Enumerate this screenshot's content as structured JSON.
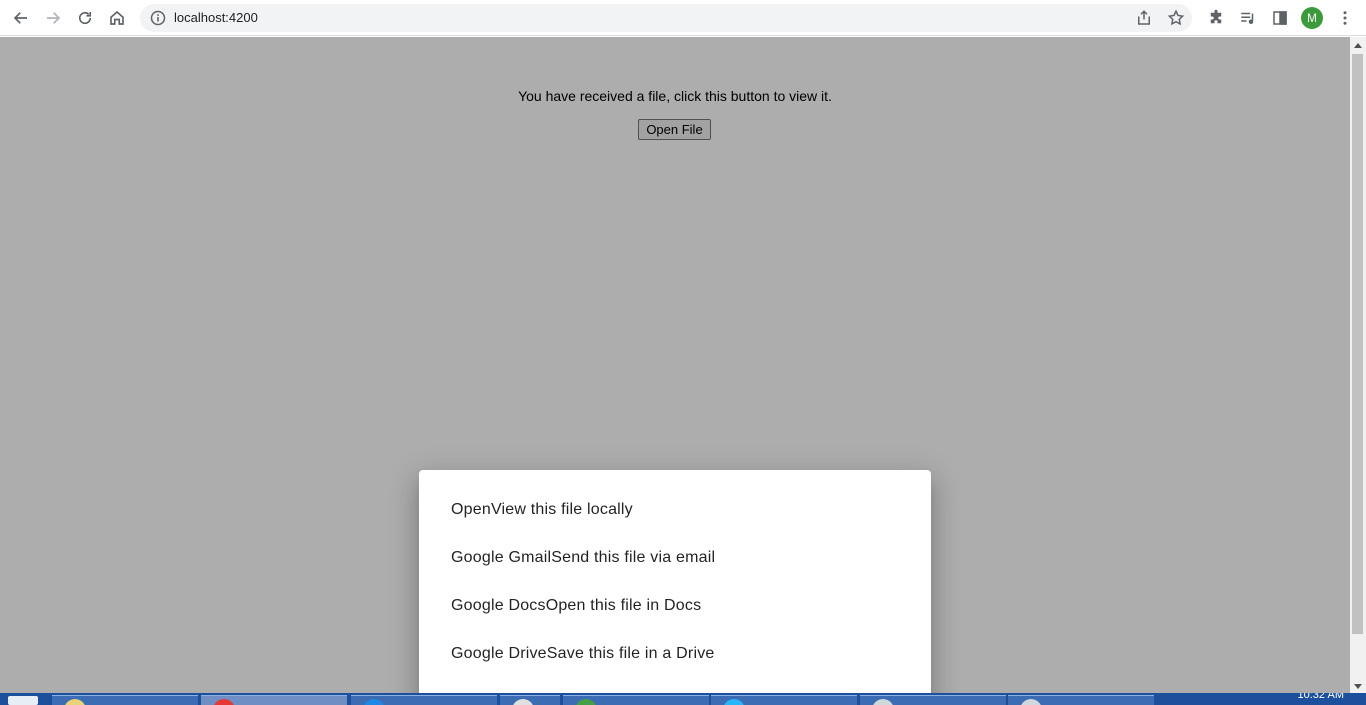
{
  "browser": {
    "url": "localhost:4200",
    "avatar_letter": "M",
    "icons": {
      "back": "back-arrow-icon",
      "forward": "forward-arrow-icon",
      "reload": "reload-icon",
      "home": "home-icon",
      "site_info": "info-icon",
      "share": "share-icon",
      "bookmark": "star-icon",
      "extensions": "puzzle-icon",
      "media": "media-queue-icon",
      "side_panel": "side-panel-icon",
      "menu": "kebab-menu-icon"
    }
  },
  "page": {
    "message": "You have received a file, click this button to view it.",
    "open_button_label": "Open File"
  },
  "bottom_sheet": {
    "items": [
      {
        "label": "OpenView this file locally"
      },
      {
        "label": "Google GmailSend this file via email"
      },
      {
        "label": "Google DocsOpen this file in Docs"
      },
      {
        "label": "Google DriveSave this file in a Drive"
      }
    ]
  },
  "taskbar": {
    "clock": "10:32 AM"
  },
  "colors": {
    "backdrop": "#adadad",
    "taskbar": "#1c4f9c",
    "avatar": "#3b9a3b"
  }
}
